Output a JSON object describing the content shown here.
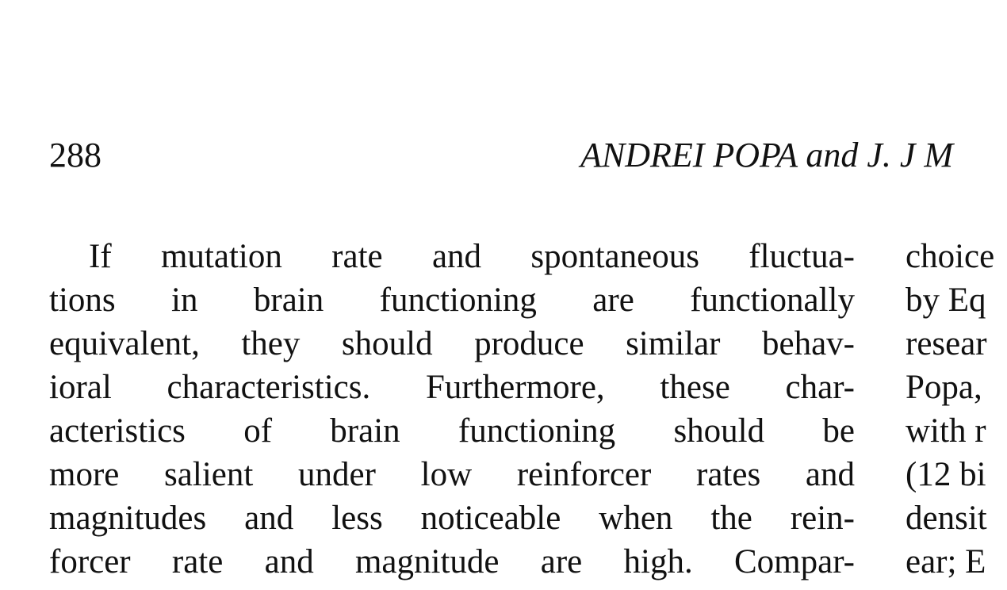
{
  "header": {
    "page_number": "288",
    "running_head": "ANDREI POPA and J. J M"
  },
  "left_column": {
    "lines": [
      "If mutation rate and spontaneous fluctua-",
      "tions in brain functioning are functionally",
      "equivalent, they should produce similar behav-",
      "ioral characteristics. Furthermore, these char-",
      "acteristics of brain functioning should be",
      "more salient under low reinforcer rates and",
      "magnitudes and less noticeable when the rein-",
      "forcer rate and magnitude are high. Compar-"
    ]
  },
  "right_column": {
    "lines": [
      "choice",
      "by Eq",
      "resear",
      "Popa,",
      "with r",
      "(12 bi",
      "densit",
      "ear; E"
    ]
  }
}
